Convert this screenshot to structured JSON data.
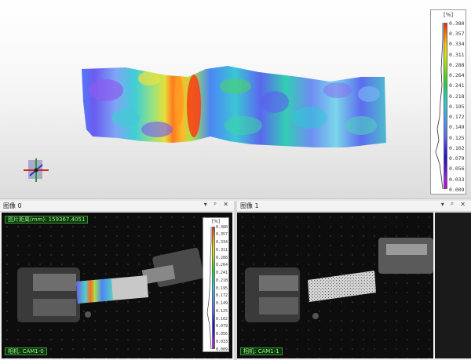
{
  "viewer3d": {
    "legend": {
      "unit": "[%]",
      "ticks": [
        "0.380",
        "0.357",
        "0.334",
        "0.311",
        "0.288",
        "0.264",
        "0.241",
        "0.218",
        "0.195",
        "0.172",
        "0.149",
        "0.125",
        "0.102",
        "0.079",
        "0.056",
        "0.033",
        "0.009"
      ]
    }
  },
  "panels": {
    "left": {
      "title": "图像 0",
      "controls": "▾ ᵖ ✕",
      "overlay_label": "图片距离(mm): 159367.4051",
      "camera_label": "相机: CAM1-0",
      "legend": {
        "unit": "[%]",
        "ticks": [
          "0.380",
          "0.357",
          "0.334",
          "0.311",
          "0.288",
          "0.264",
          "0.241",
          "0.218",
          "0.195",
          "0.172",
          "0.149",
          "0.125",
          "0.102",
          "0.079",
          "0.056",
          "0.033",
          "0.009"
        ]
      }
    },
    "right": {
      "title": "图像 1",
      "controls": "▾ ᵖ ✕",
      "camera_label": "相机: CAM1-1"
    }
  },
  "colors": {
    "colormap": [
      "#ff2200",
      "#ff7700",
      "#ffbf00",
      "#dfe600",
      "#9ee600",
      "#4fdc00",
      "#12d64a",
      "#15d3a6",
      "#2bc9d9",
      "#3aa6f0",
      "#4f86f6",
      "#5d68f2",
      "#3a33e6",
      "#2010d0",
      "#5510d8",
      "#9a20e8",
      "#c600e6"
    ],
    "panel_title_bg": "#f3f3f3",
    "camera_bg": "#0b0b0b",
    "overlay_text": "#8dff7a"
  }
}
